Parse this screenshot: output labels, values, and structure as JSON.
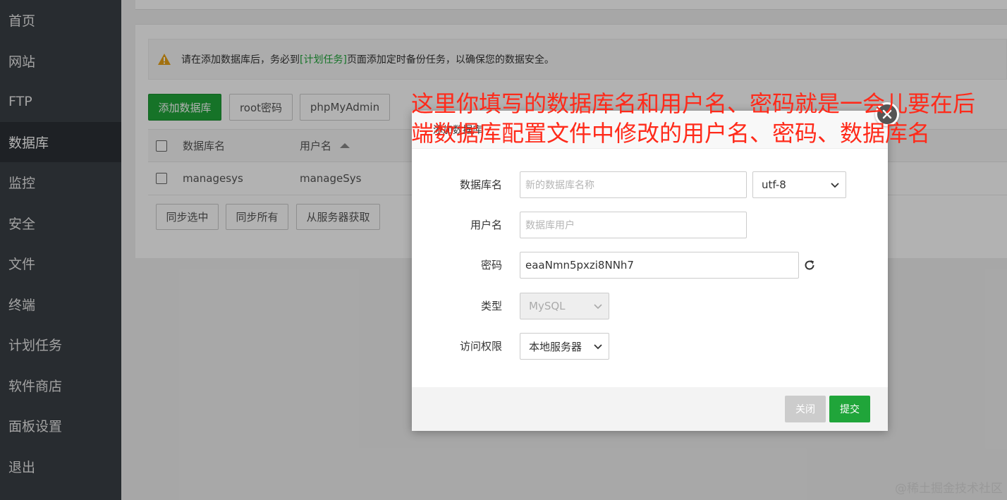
{
  "sidebar": {
    "items": [
      {
        "label": "首页"
      },
      {
        "label": "网站"
      },
      {
        "label": "FTP"
      },
      {
        "label": "数据库",
        "active": true
      },
      {
        "label": "监控"
      },
      {
        "label": "安全"
      },
      {
        "label": "文件"
      },
      {
        "label": "终端"
      },
      {
        "label": "计划任务"
      },
      {
        "label": "软件商店"
      },
      {
        "label": "面板设置"
      },
      {
        "label": "退出"
      }
    ]
  },
  "alert": {
    "prefix": "请在添加数据库后，务必到",
    "link": "[计划任务]",
    "suffix": "页面添加定时备份任务，以确保您的数据安全。"
  },
  "toolbar": {
    "add_db": "添加数据库",
    "root_pwd": "root密码",
    "phpmyadmin": "phpMyAdmin"
  },
  "table": {
    "headers": {
      "name": "数据库名",
      "user": "用户名"
    },
    "rows": [
      {
        "name": "managesys",
        "user": "manageSys"
      }
    ]
  },
  "bottom_buttons": {
    "sync_selected": "同步选中",
    "sync_all": "同步所有",
    "fetch_server": "从服务器获取"
  },
  "modal": {
    "title": "添加数据库",
    "fields": {
      "db_name_label": "数据库名",
      "db_name_placeholder": "新的数据库名称",
      "charset": "utf-8",
      "username_label": "用户名",
      "username_placeholder": "数据库用户",
      "password_label": "密码",
      "password_value": "eaaNmn5pxzi8NNh7",
      "type_label": "类型",
      "type_value": "MySQL",
      "access_label": "访问权限",
      "access_value": "本地服务器"
    },
    "close_label": "关闭",
    "submit_label": "提交"
  },
  "annotation": {
    "line1": "这里你填写的数据库名和用户名、密码就是一会儿要在后",
    "line2": "端数据库配置文件中修改的用户名、密码、数据库名"
  },
  "watermark": "@稀土掘金技术社区",
  "colors": {
    "sidebar_bg": "#3a3f45",
    "accent_green": "#20a53a",
    "annotation_red": "#ff2a1a"
  }
}
